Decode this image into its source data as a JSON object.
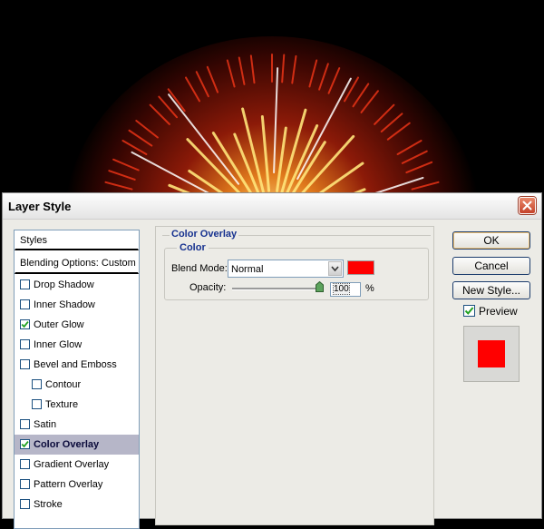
{
  "dialog": {
    "title": "Layer Style",
    "close_icon": "close-icon"
  },
  "styles_panel": {
    "header": "Styles",
    "blending": "Blending Options: Custom",
    "items": [
      {
        "label": "Drop Shadow",
        "checked": false,
        "indent": false,
        "selected": false
      },
      {
        "label": "Inner Shadow",
        "checked": false,
        "indent": false,
        "selected": false
      },
      {
        "label": "Outer Glow",
        "checked": true,
        "indent": false,
        "selected": false
      },
      {
        "label": "Inner Glow",
        "checked": false,
        "indent": false,
        "selected": false
      },
      {
        "label": "Bevel and Emboss",
        "checked": false,
        "indent": false,
        "selected": false
      },
      {
        "label": "Contour",
        "checked": false,
        "indent": true,
        "selected": false
      },
      {
        "label": "Texture",
        "checked": false,
        "indent": true,
        "selected": false
      },
      {
        "label": "Satin",
        "checked": false,
        "indent": false,
        "selected": false
      },
      {
        "label": "Color Overlay",
        "checked": true,
        "indent": false,
        "selected": true
      },
      {
        "label": "Gradient Overlay",
        "checked": false,
        "indent": false,
        "selected": false
      },
      {
        "label": "Pattern Overlay",
        "checked": false,
        "indent": false,
        "selected": false
      },
      {
        "label": "Stroke",
        "checked": false,
        "indent": false,
        "selected": false
      }
    ]
  },
  "color_overlay": {
    "section_title": "Color Overlay",
    "group_title": "Color",
    "blend_mode_label": "Blend Mode:",
    "blend_mode_value": "Normal",
    "overlay_color": "#ff0000",
    "opacity_label": "Opacity:",
    "opacity_value": "100",
    "opacity_unit": "%",
    "opacity_level": 1.0
  },
  "buttons": {
    "ok": "OK",
    "cancel": "Cancel",
    "new_style": "New Style..."
  },
  "preview": {
    "label": "Preview",
    "checked": true,
    "swatch_color": "#ff0000"
  }
}
